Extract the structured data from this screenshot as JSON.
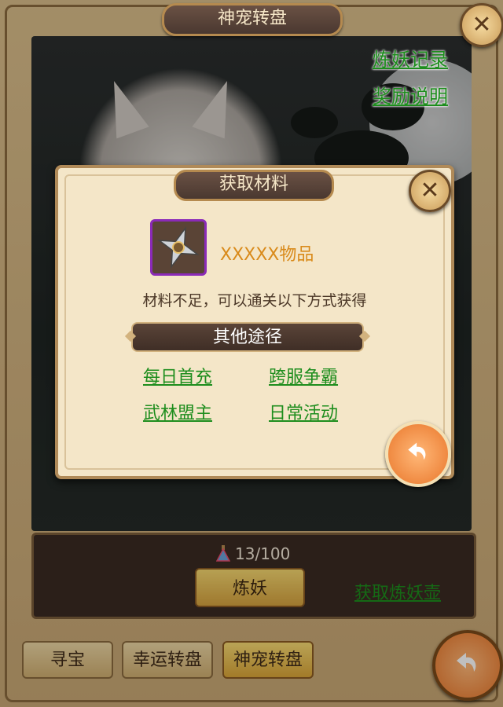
{
  "window": {
    "title": "神宠转盘"
  },
  "top_links": {
    "record": "炼妖记录",
    "reward_info": "奖励说明"
  },
  "bottom_panel": {
    "counter": "13/100",
    "refine_button": "炼妖",
    "get_pot_link": "获取炼妖壶"
  },
  "tabs": [
    {
      "label": "寻宝",
      "active": false
    },
    {
      "label": "幸运转盘",
      "active": false
    },
    {
      "label": "神宠转盘",
      "active": true
    }
  ],
  "popup": {
    "title": "获取材料",
    "item_name": "XXXXX物品",
    "notice": "材料不足，可以通关以下方式获得",
    "other_ways_title": "其他途径",
    "ways": [
      "每日首充",
      "跨服争霸",
      "武林盟主",
      "日常活动"
    ]
  },
  "colors": {
    "link_green": "#1d8d1d",
    "item_orange": "#d98a1a",
    "rare_border_purple": "#8b2ab8"
  },
  "icons": {
    "close": "close-icon",
    "back": "back-arrow-icon",
    "item": "shuriken-icon",
    "counter": "potion-icon"
  }
}
